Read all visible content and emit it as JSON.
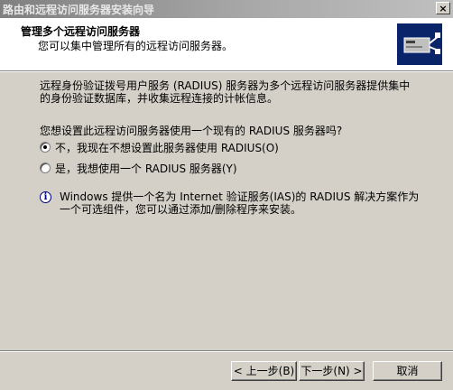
{
  "window": {
    "title": "路由和远程访问服务器安装向导",
    "close_label": "×"
  },
  "header": {
    "title": "管理多个远程访问服务器",
    "subtitle": "您可以集中管理所有的远程访问服务器。"
  },
  "body": {
    "description_line1": "远程身份验证拨号用户服务 (RADIUS) 服务器为多个远程访问服务器提供集中",
    "description_line2": "的身份验证数据库，并收集远程连接的计帐信息。",
    "question": "您想设置此远程访问服务器使用一个现有的 RADIUS 服务器吗?",
    "options": [
      {
        "label": "不，我现在不想设置此服务器使用 RADIUS(O)",
        "checked": true
      },
      {
        "label": "是，我想使用一个 RADIUS 服务器(Y)",
        "checked": false
      }
    ],
    "info_line1": "Windows 提供一个名为 Internet 验证服务(IAS)的 RADIUS 解决方案作为",
    "info_line2": "一个可选组件，您可以通过添加/删除程序来安装。"
  },
  "buttons": {
    "back": "< 上一步(B)",
    "next": "下一步(N) >",
    "cancel": "取消"
  }
}
